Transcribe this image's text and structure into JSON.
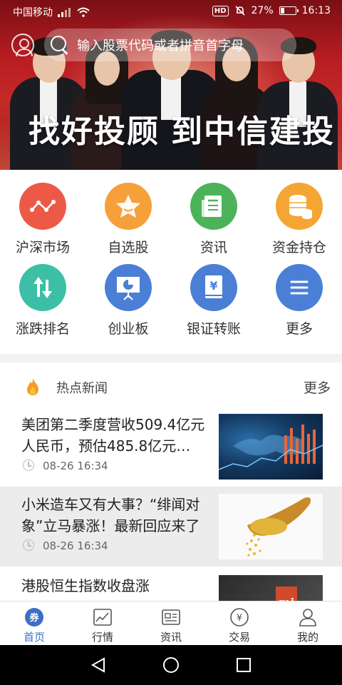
{
  "status_bar": {
    "carrier": "中国移动",
    "battery": "27%",
    "battery_level": 0.27,
    "time": "16:13",
    "hd_label": "HD"
  },
  "banner": {
    "search_placeholder": "输入股票代码或者拼音首字母",
    "slogan_left": "找好投顾",
    "slogan_right": "到中信建投"
  },
  "menu": [
    {
      "label": "沪深市场",
      "icon": "market-line-icon",
      "color": "#ec5a47"
    },
    {
      "label": "自选股",
      "icon": "star-icon",
      "color": "#f5a03b"
    },
    {
      "label": "资讯",
      "icon": "newspaper-icon",
      "color": "#4cb35a"
    },
    {
      "label": "资金持仓",
      "icon": "coins-icon",
      "color": "#f5a533"
    },
    {
      "label": "涨跌排名",
      "icon": "up-down-arrows-icon",
      "color": "#3cbfa6"
    },
    {
      "label": "创业板",
      "icon": "presentation-board-icon",
      "color": "#4b7fd6"
    },
    {
      "label": "银证转账",
      "icon": "yen-book-icon",
      "color": "#4b7fd6"
    },
    {
      "label": "更多",
      "icon": "menu-lines-icon",
      "color": "#4b7fd6"
    }
  ],
  "news_section": {
    "title": "热点新闻",
    "more": "更多"
  },
  "news": [
    {
      "headline": "美团第二季度营收509.4亿元人民币，预估485.8亿元…",
      "time": "08-26 16:34"
    },
    {
      "headline": "小米造车又有大事？“绯闻对象”立马暴涨！最新回应来了",
      "time": "08-26 16:34"
    },
    {
      "headline": "港股恒生指数收盘涨",
      "time": ""
    }
  ],
  "tabs": [
    {
      "label": "首页",
      "icon": "coupon-icon",
      "active": true
    },
    {
      "label": "行情",
      "icon": "chart-icon",
      "active": false
    },
    {
      "label": "资讯",
      "icon": "news-card-icon",
      "active": false
    },
    {
      "label": "交易",
      "icon": "yen-circle-icon",
      "active": false
    },
    {
      "label": "我的",
      "icon": "person-icon",
      "active": false
    }
  ],
  "tab_home_badge": "券"
}
